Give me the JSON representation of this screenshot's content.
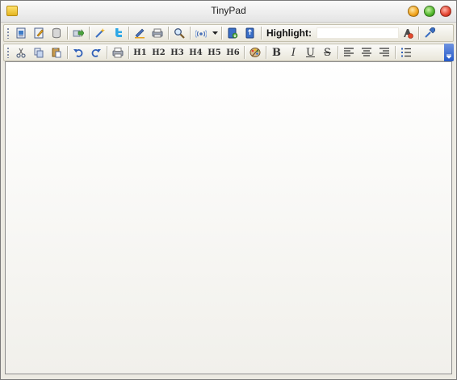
{
  "window": {
    "title": "TinyPad"
  },
  "toolbar_main": {
    "highlight_label": "Highlight:",
    "highlight_value": "",
    "icons": [
      "new-document-icon",
      "edit-document-icon",
      "database-icon",
      "forward-icon",
      "wand-icon",
      "twitter-icon",
      "pen-icon",
      "print-preview-icon",
      "search-icon",
      "broadcast-icon",
      "dropdown-arrow-icon",
      "download-icon",
      "upload-icon",
      "highlight-clear-icon",
      "eyedropper-icon"
    ]
  },
  "toolbar_format": {
    "headings": [
      "H1",
      "H2",
      "H3",
      "H4",
      "H5",
      "H6"
    ],
    "bold": "B",
    "italic": "I",
    "underline": "U",
    "strike": "S"
  },
  "editor": {
    "content": ""
  },
  "colors": {
    "accent_blue": "#2459c8",
    "toolbar_border": "#c4c0ae",
    "editor_border": "#8f8f8f"
  }
}
